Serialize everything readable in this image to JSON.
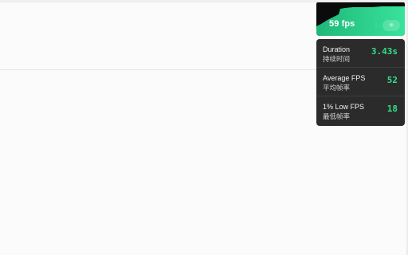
{
  "fps_monitor": {
    "fps_label": "59 fps",
    "fps_value": 59,
    "accent_color": "#32e08a",
    "toggle_icon": "eye-icon",
    "stats": [
      {
        "label_en": "Duration",
        "label_zh": "持续时间",
        "value": "3.43s"
      },
      {
        "label_en": "Average FPS",
        "label_zh": "平均帧率",
        "value": "52"
      },
      {
        "label_en": "1% Low FPS",
        "label_zh": "最低帧率",
        "value": "18"
      }
    ]
  }
}
